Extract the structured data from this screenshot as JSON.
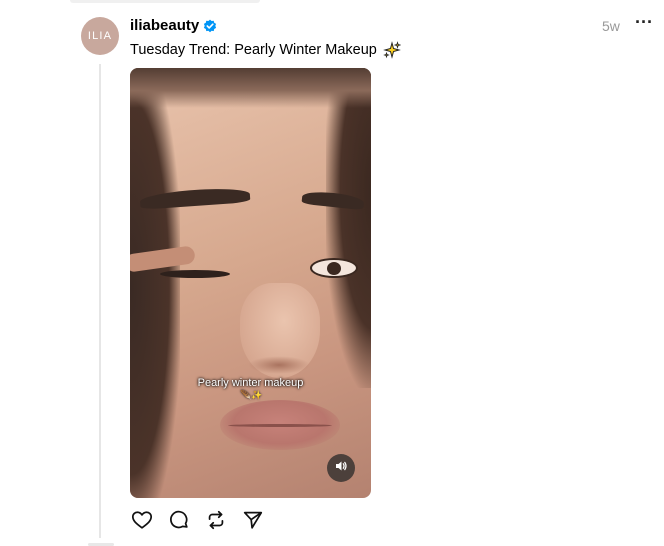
{
  "post": {
    "avatar_text": "ILIA",
    "username": "iliabeauty",
    "verified": true,
    "timestamp": "5w",
    "caption": "Tuesday Trend: Pearly Winter Makeup",
    "caption_emoji": "sparkles-icon",
    "more_label": "···"
  },
  "media": {
    "type": "video",
    "overlay_text": "Pearly winter makeup",
    "overlay_emoji": "🪶✨",
    "sound_icon": "speaker-icon"
  },
  "actions": [
    {
      "name": "like",
      "icon": "heart-icon"
    },
    {
      "name": "comment",
      "icon": "comment-icon"
    },
    {
      "name": "repost",
      "icon": "repost-icon"
    },
    {
      "name": "share",
      "icon": "send-icon"
    }
  ],
  "colors": {
    "verified": "#0095f6",
    "avatar_bg": "#c8a89d",
    "muted_text": "#999999"
  }
}
